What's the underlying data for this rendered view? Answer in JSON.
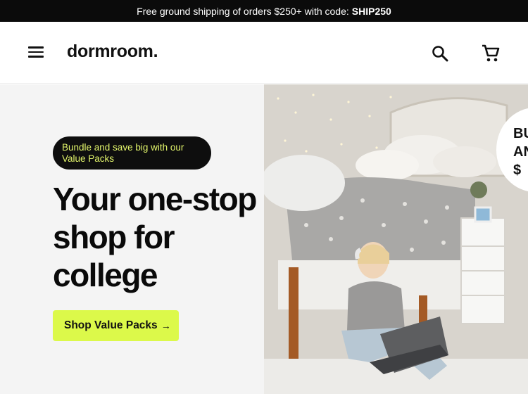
{
  "promo": {
    "text": "Free ground shipping of orders $250+ with code:",
    "code": "SHIP250"
  },
  "header": {
    "logo": "dormroom.",
    "menu_icon": "hamburger-menu-icon",
    "search_icon": "search-icon",
    "cart_icon": "shopping-cart-icon"
  },
  "hero": {
    "badge": "Bundle and save big with our Value Packs",
    "headline": "Your one-stop shop for college",
    "cta_label": "Shop Value Packs",
    "cta_arrow": "→",
    "sticker_lines": [
      "BU",
      "ANI",
      "$"
    ],
    "image_subject": "dorm-room-photo"
  },
  "colors": {
    "accent": "#dcf94a",
    "badge_text": "#e2f56b",
    "promo_bg": "#0b0b0b",
    "hero_bg": "#f4f4f4"
  }
}
